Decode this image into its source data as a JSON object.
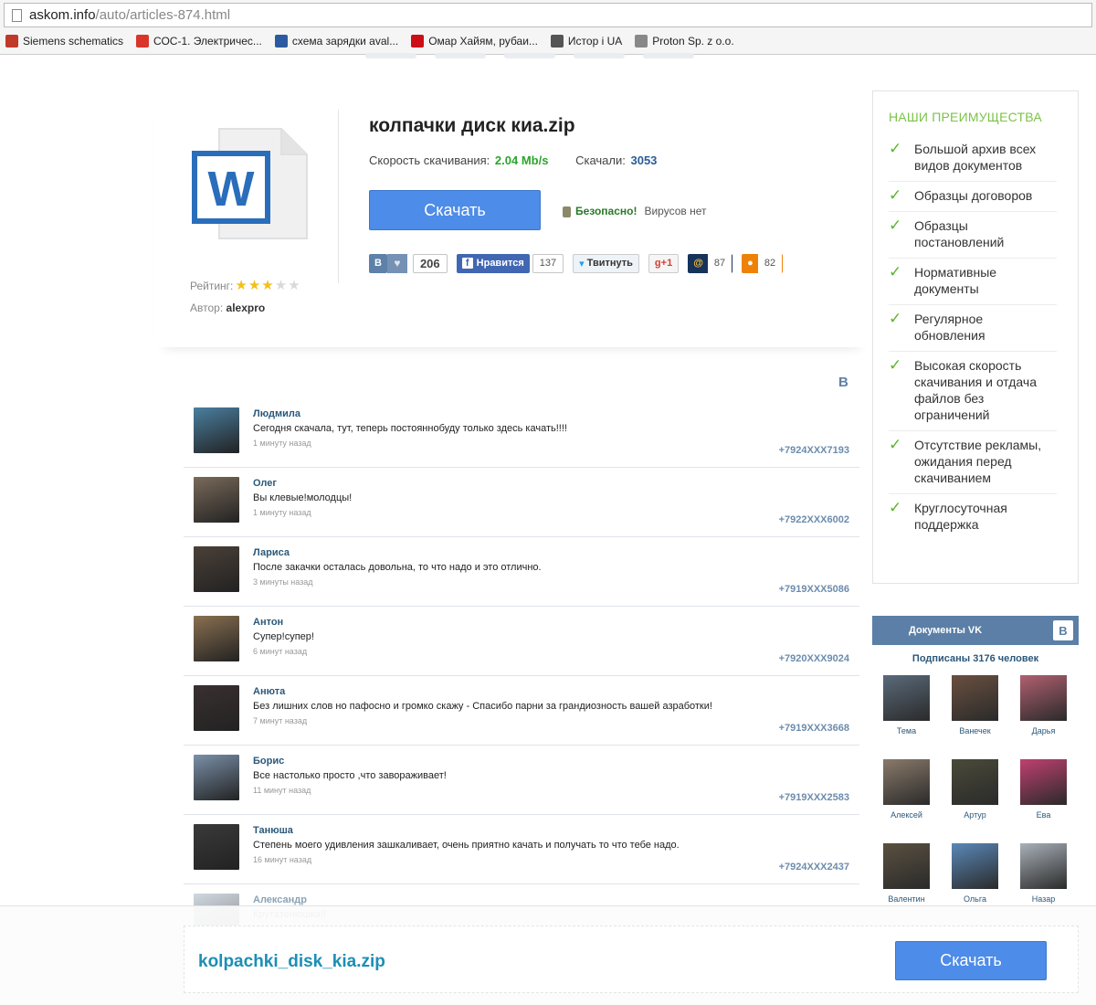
{
  "browser": {
    "url_host": "askom.info",
    "url_path": "/auto/articles-874.html",
    "bookmarks": [
      {
        "label": "Siemens schematics",
        "icon": "siemens-icon",
        "color": "#c0392b"
      },
      {
        "label": "СОС-1. Электричес...",
        "icon": "pdf-icon",
        "color": "#d9352b"
      },
      {
        "label": "схема зарядки aval...",
        "icon": "floppy-icon",
        "color": "#2c5aa0"
      },
      {
        "label": "Омар Хайям, рубаи...",
        "icon": "opera-icon",
        "color": "#cc0f16"
      },
      {
        "label": "Истор і UA",
        "icon": "tools-icon",
        "color": "#555555"
      },
      {
        "label": "Proton Sp. z o.o.",
        "icon": "document-icon",
        "color": "#888888"
      }
    ]
  },
  "file": {
    "title": "колпачки диск киа.zip",
    "speed_label": "Скорость скачивания:",
    "speed_value": "2.04 Mb/s",
    "downloads_label": "Скачали:",
    "downloads_value": "3053",
    "download_button": "Скачать",
    "safe_label": "Безопасно!",
    "virus_label": "Вирусов нет",
    "rating_label": "Рейтинг:",
    "rating_stars": 3,
    "rating_max": 5,
    "author_label": "Автор:",
    "author_name": "alexpro"
  },
  "social": {
    "vk_label": "B",
    "vk_count": "206",
    "fb_label": "Нравится",
    "fb_count": "137",
    "tw_label": "Твитнуть",
    "gp_label": "+1",
    "mr_label": "@",
    "mr_count": "87",
    "ok_label": "ok",
    "ok_count": "82"
  },
  "advantages": {
    "title": "НАШИ ПРЕИМУЩЕСТВА",
    "items": [
      "Большой архив всех видов документов",
      "Образцы договоров",
      "Образцы постановлений",
      "Нормативные документы",
      "Регулярное обновления",
      "Высокая скорость скачивания и отдача файлов без ограничений",
      "Отсутствие рекламы, ожидания перед скачиванием",
      "Круглосуточная поддержка"
    ]
  },
  "comments_logo": "B",
  "comments": [
    {
      "name": "Людмила",
      "text": "Сегодня скачала, тут, теперь постояннобуду только здесь качать!!!!",
      "time": "1 минуту назад",
      "phone": "+7924XXX7193",
      "avatar_color": "#4a7fa0"
    },
    {
      "name": "Олег",
      "text": "Вы клевые!молодцы!",
      "time": "1 минуту назад",
      "phone": "+7922XXX6002",
      "avatar_color": "#7a6a5a"
    },
    {
      "name": "Лариса",
      "text": "После закачки осталась довольна, то что надо и это отлично.",
      "time": "3 минуты назад",
      "phone": "+7919XXX5086",
      "avatar_color": "#4a4038"
    },
    {
      "name": "Антон",
      "text": "Супер!супер!",
      "time": "6 минут назад",
      "phone": "+7920XXX9024",
      "avatar_color": "#8a7050"
    },
    {
      "name": "Анюта",
      "text": "Без лишних слов но пафосно и громко скажу - Спасибо парни за грандиозность вашей азработки!",
      "time": "7 минут назад",
      "phone": "+7919XXX3668",
      "avatar_color": "#3a3030"
    },
    {
      "name": "Борис",
      "text": "Все настолько просто ,что завораживает!",
      "time": "11 минут назад",
      "phone": "+7919XXX2583",
      "avatar_color": "#7a90a8"
    },
    {
      "name": "Танюша",
      "text": "Степень моего удивления зашкаливает, очень приятно качать и получать то что тебе надо.",
      "time": "16 минут назад",
      "phone": "+7924XXX2437",
      "avatar_color": "#3a3a3a"
    },
    {
      "name": "Александр",
      "text": "Крутатенюшка!!",
      "time": "",
      "phone": "",
      "avatar_color": "#a8b8c8"
    }
  ],
  "vk_widget": {
    "title": "Документы VK",
    "logo": "B",
    "subscribers": "Подписаны 3176 человек",
    "members": [
      {
        "name": "Тема",
        "color": "#5a6a7a"
      },
      {
        "name": "Ванечек",
        "color": "#6a5040"
      },
      {
        "name": "Дарья",
        "color": "#b06070"
      },
      {
        "name": "Алексей",
        "color": "#8a7a6a"
      },
      {
        "name": "Артур",
        "color": "#4a4a3a"
      },
      {
        "name": "Ева",
        "color": "#c04070"
      },
      {
        "name": "Валентин",
        "color": "#5a5040"
      },
      {
        "name": "Ольга",
        "color": "#5a88b8"
      },
      {
        "name": "Назар",
        "color": "#a8b0b8"
      }
    ]
  },
  "sticky": {
    "filename": "kolpachki_disk_kia.zip",
    "download_button": "Скачать"
  }
}
